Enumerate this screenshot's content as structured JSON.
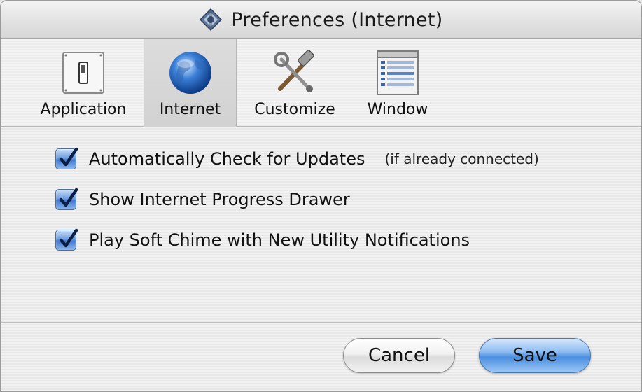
{
  "window": {
    "title": "Preferences (Internet)",
    "title_icon": "preferences-app-icon"
  },
  "toolbar": {
    "items": [
      {
        "label": "Application",
        "icon": "switch-icon",
        "selected": false
      },
      {
        "label": "Internet",
        "icon": "globe-icon",
        "selected": true
      },
      {
        "label": "Customize",
        "icon": "tools-icon",
        "selected": false
      },
      {
        "label": "Window",
        "icon": "window-list-icon",
        "selected": false
      }
    ]
  },
  "options": [
    {
      "label": "Automatically Check for Updates",
      "note": "(if already connected)",
      "checked": true
    },
    {
      "label": "Show Internet Progress Drawer",
      "note": "",
      "checked": true
    },
    {
      "label": "Play Soft Chime with New Utility Notifications",
      "note": "",
      "checked": true
    }
  ],
  "buttons": {
    "cancel": "Cancel",
    "save": "Save"
  },
  "colors": {
    "accent_blue": "#4a8ee0",
    "checkbox_blue": "#3f78cf"
  }
}
